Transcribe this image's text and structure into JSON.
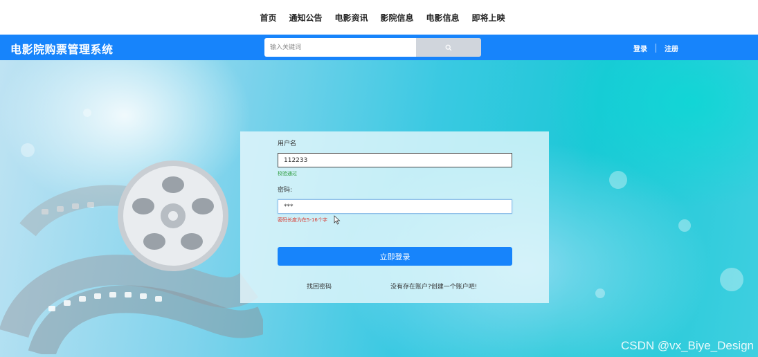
{
  "topnav": {
    "items": [
      "首页",
      "通知公告",
      "电影资讯",
      "影院信息",
      "电影信息",
      "即将上映"
    ]
  },
  "header": {
    "brand": "电影院购票管理系统",
    "search_placeholder": "输入关键词",
    "login": "登录",
    "register": "注册"
  },
  "form": {
    "username_label": "用户名",
    "username_value": "112233",
    "username_hint": "校验通过",
    "password_label": "密码:",
    "password_value": "***",
    "password_hint": "密码长度为在5-16个字",
    "submit_label": "立即登录",
    "forgot_link": "找回密码",
    "register_link": "没有存在账户?创建一个账户吧!"
  },
  "watermark": "CSDN @vx_Biye_Design",
  "colors": {
    "primary": "#1784fb",
    "hint_ok": "#2a9a3a",
    "hint_err": "#d9362b"
  }
}
